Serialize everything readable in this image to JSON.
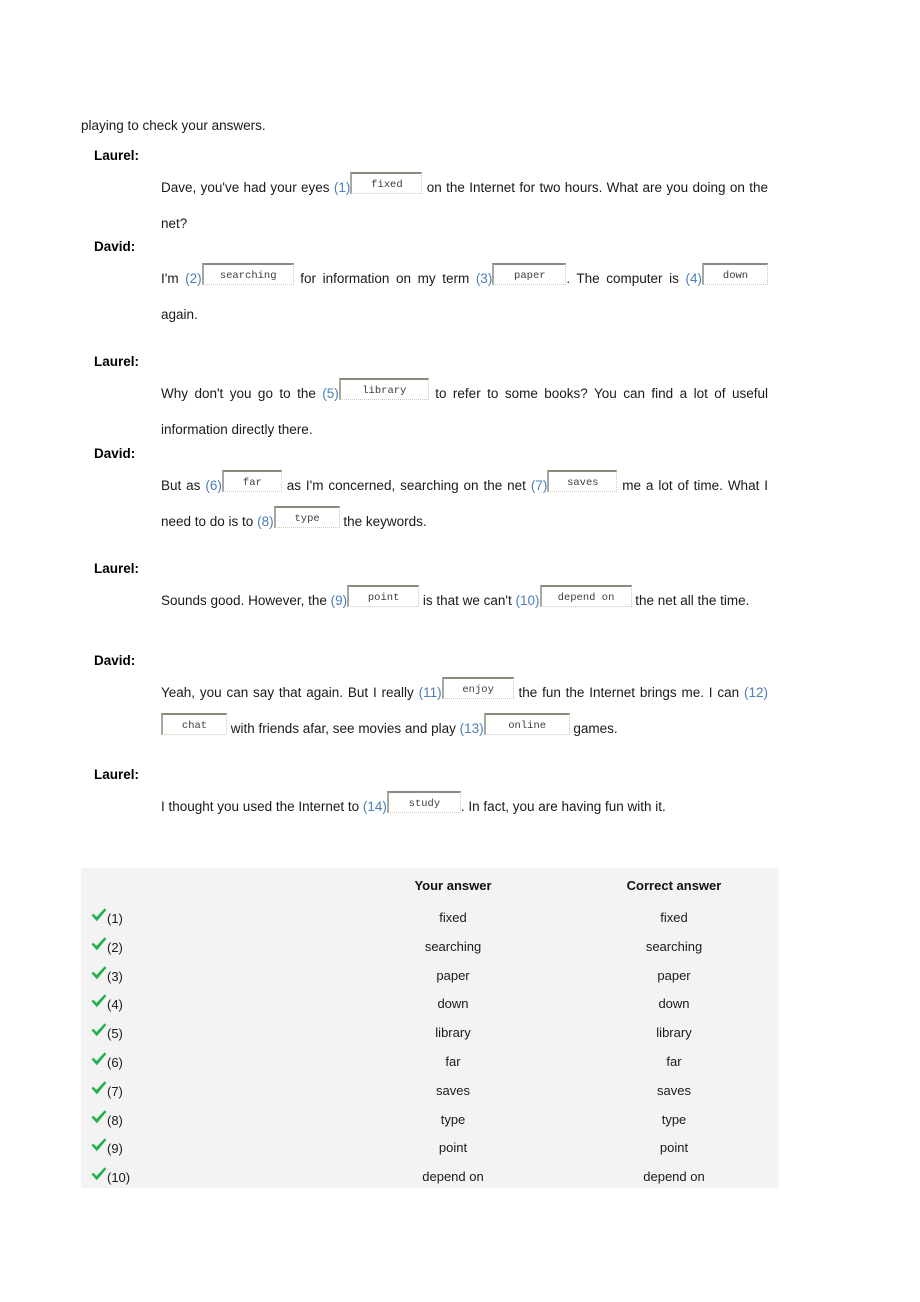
{
  "intro": {
    "text": "playing to check your answers."
  },
  "dialogue": [
    {
      "speaker": "Laurel:",
      "segments": [
        {
          "kind": "text",
          "value": "Dave, you've had your eyes "
        },
        {
          "kind": "num",
          "value": "(1)"
        },
        {
          "kind": "box",
          "value": "fixed",
          "width": "w72"
        },
        {
          "kind": "text",
          "value": " on the Internet for two hours. What are you doing on the net?"
        }
      ]
    },
    {
      "speaker": "David:",
      "segments": [
        {
          "kind": "text",
          "value": "I'm "
        },
        {
          "kind": "num",
          "value": "(2)"
        },
        {
          "kind": "box",
          "value": "searching",
          "width": "w92"
        },
        {
          "kind": "text",
          "value": " for information on my term "
        },
        {
          "kind": "num",
          "value": "(3)"
        },
        {
          "kind": "box",
          "value": "paper",
          "width": "w74"
        },
        {
          "kind": "text",
          "value": ". The computer is "
        },
        {
          "kind": "num",
          "value": "(4)"
        },
        {
          "kind": "box",
          "value": "down",
          "width": "w66"
        },
        {
          "kind": "text",
          "value": " again."
        }
      ]
    },
    {
      "speaker": "Laurel:",
      "segments": [
        {
          "kind": "text",
          "value": "Why don't you go to the "
        },
        {
          "kind": "num",
          "value": "(5)"
        },
        {
          "kind": "box",
          "value": "library",
          "width": "w90"
        },
        {
          "kind": "text",
          "value": " to refer to some books? You can find a lot of useful information directly there."
        }
      ]
    },
    {
      "speaker": "David:",
      "segments": [
        {
          "kind": "text",
          "value": "But as "
        },
        {
          "kind": "num",
          "value": "(6)"
        },
        {
          "kind": "box",
          "value": "far",
          "width": "w60"
        },
        {
          "kind": "text",
          "value": " as I'm concerned, searching on the net "
        },
        {
          "kind": "num",
          "value": "(7)"
        },
        {
          "kind": "box",
          "value": "saves",
          "width": "w70"
        },
        {
          "kind": "text",
          "value": " me a lot of time. What I need to do is to "
        },
        {
          "kind": "num",
          "value": "(8)"
        },
        {
          "kind": "box",
          "value": "type",
          "width": "w66"
        },
        {
          "kind": "text",
          "value": " the keywords."
        }
      ]
    },
    {
      "speaker": "Laurel:",
      "segments": [
        {
          "kind": "text",
          "value": "Sounds good. However, the "
        },
        {
          "kind": "num",
          "value": "(9)"
        },
        {
          "kind": "box",
          "value": "point",
          "width": "w72"
        },
        {
          "kind": "text",
          "value": " is that we can't "
        },
        {
          "kind": "num",
          "value": "(10)"
        },
        {
          "kind": "box",
          "value": "depend on",
          "width": "w92"
        },
        {
          "kind": "text",
          "value": " the net all the time."
        }
      ]
    },
    {
      "speaker": "David:",
      "segments": [
        {
          "kind": "text",
          "value": "Yeah, you can say that again. But I really "
        },
        {
          "kind": "num",
          "value": "(11)"
        },
        {
          "kind": "box",
          "value": "enjoy",
          "width": "w72"
        },
        {
          "kind": "text",
          "value": " the fun the Internet brings me. I can "
        },
        {
          "kind": "num",
          "value": "(12)"
        },
        {
          "kind": "box",
          "value": "chat",
          "width": "w66"
        },
        {
          "kind": "text",
          "value": " with friends afar, see movies and play "
        },
        {
          "kind": "num",
          "value": "(13)"
        },
        {
          "kind": "box",
          "value": "online",
          "width": "w86"
        },
        {
          "kind": "text",
          "value": " games."
        }
      ]
    },
    {
      "speaker": "Laurel:",
      "segments": [
        {
          "kind": "text",
          "value": "I thought you used the Internet to "
        },
        {
          "kind": "num",
          "value": "(14)"
        },
        {
          "kind": "box",
          "value": "study",
          "width": "w74"
        },
        {
          "kind": "text",
          "value": ". In fact, you are having fun with it."
        }
      ]
    }
  ],
  "results": {
    "columns": {
      "your_answer": "Your answer",
      "correct_answer": "Correct answer"
    },
    "status_icon": "green-check-icon",
    "accent_color": "#22b14c",
    "background_color": "#f3f3f3",
    "rows": [
      {
        "index": "(1)",
        "status": "correct",
        "your": "fixed",
        "correct": "fixed"
      },
      {
        "index": "(2)",
        "status": "correct",
        "your": "searching",
        "correct": "searching"
      },
      {
        "index": "(3)",
        "status": "correct",
        "your": "paper",
        "correct": "paper"
      },
      {
        "index": "(4)",
        "status": "correct",
        "your": "down",
        "correct": "down"
      },
      {
        "index": "(5)",
        "status": "correct",
        "your": "library",
        "correct": "library"
      },
      {
        "index": "(6)",
        "status": "correct",
        "your": "far",
        "correct": "far"
      },
      {
        "index": "(7)",
        "status": "correct",
        "your": "saves",
        "correct": "saves"
      },
      {
        "index": "(8)",
        "status": "correct",
        "your": "type",
        "correct": "type"
      },
      {
        "index": "(9)",
        "status": "correct",
        "your": "point",
        "correct": "point"
      },
      {
        "index": "(10)",
        "status": "correct",
        "your": "depend on",
        "correct": "depend on"
      }
    ]
  },
  "theme": {
    "blank_number_color": "#4a7ebc",
    "text_color": "#1a1a1a"
  }
}
